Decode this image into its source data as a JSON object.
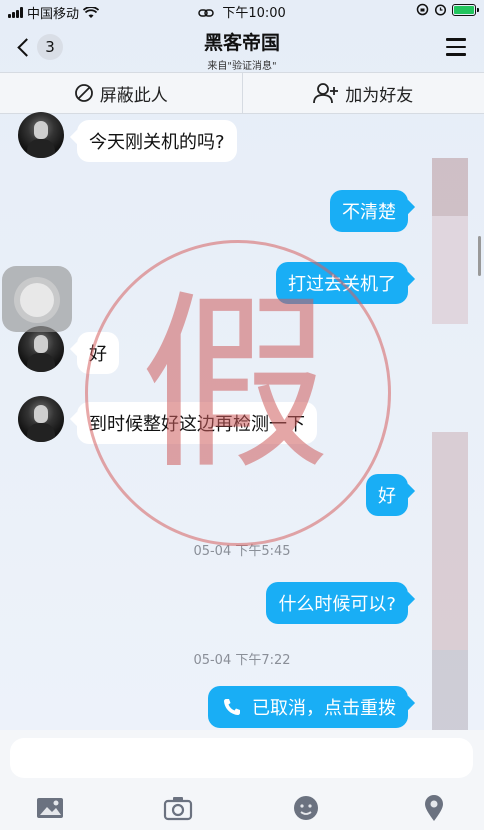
{
  "status_bar": {
    "carrier": "中国移动",
    "time": "下午10:00"
  },
  "header": {
    "back_count": "3",
    "title": "黑客帝国",
    "subtitle": "来自\"验证消息\""
  },
  "action_bar": {
    "block_label": "屏蔽此人",
    "add_friend_label": "加为好友"
  },
  "messages": [
    {
      "side": "in",
      "text": "今天刚关机的吗?"
    },
    {
      "side": "out",
      "text": "不清楚"
    },
    {
      "side": "out",
      "text": "打过去关机了"
    },
    {
      "side": "in",
      "text": "好"
    },
    {
      "side": "in",
      "text": "到时候整好这边再检测一下"
    },
    {
      "side": "out",
      "text": "好"
    },
    {
      "side": "out",
      "text": "什么时候可以?"
    },
    {
      "side": "out",
      "text": "已取消，点击重拨"
    }
  ],
  "timestamps": [
    "05-04 下午5:45",
    "05-04 下午7:22"
  ],
  "watermark": "假",
  "colors": {
    "outgoing_bubble": "#19aef5",
    "incoming_bubble": "#ffffff",
    "stamp": "#ce5c5c"
  },
  "icons": [
    "image-icon",
    "camera-icon",
    "emoji-icon",
    "location-icon",
    "phone-icon",
    "block-icon",
    "add-friend-icon",
    "menu-icon"
  ]
}
